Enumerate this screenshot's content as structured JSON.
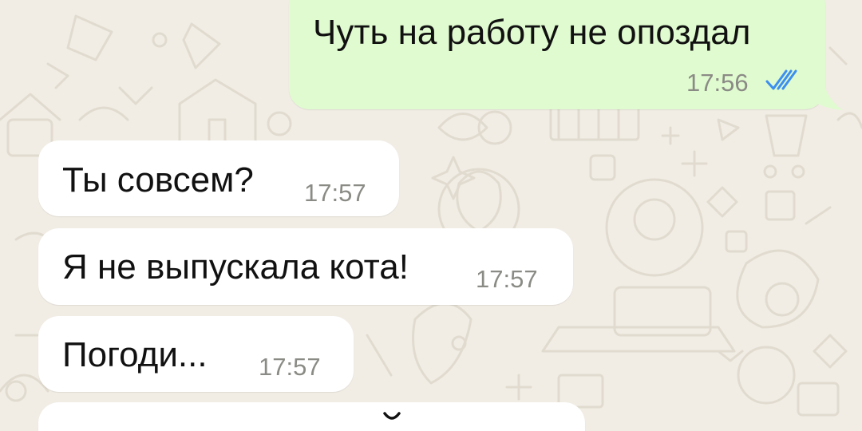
{
  "colors": {
    "wallpaper": "#f1ede5",
    "outgoing_bubble": "#e0fbcf",
    "incoming_bubble": "#ffffff",
    "time_text": "#8b8b86",
    "read_checks": "#3c8ff0"
  },
  "messages": [
    {
      "direction": "outgoing",
      "text": "Чуть на работу не опоздал",
      "time": "17:56",
      "status_icon": "double-check-read-icon"
    },
    {
      "direction": "incoming",
      "text": "Ты совсем?",
      "time": "17:57"
    },
    {
      "direction": "incoming",
      "text": "Я не выпускала кота!",
      "time": "17:57"
    },
    {
      "direction": "incoming",
      "text": "Погоди...",
      "time": "17:57"
    },
    {
      "direction": "incoming",
      "text": "",
      "time": ""
    }
  ]
}
